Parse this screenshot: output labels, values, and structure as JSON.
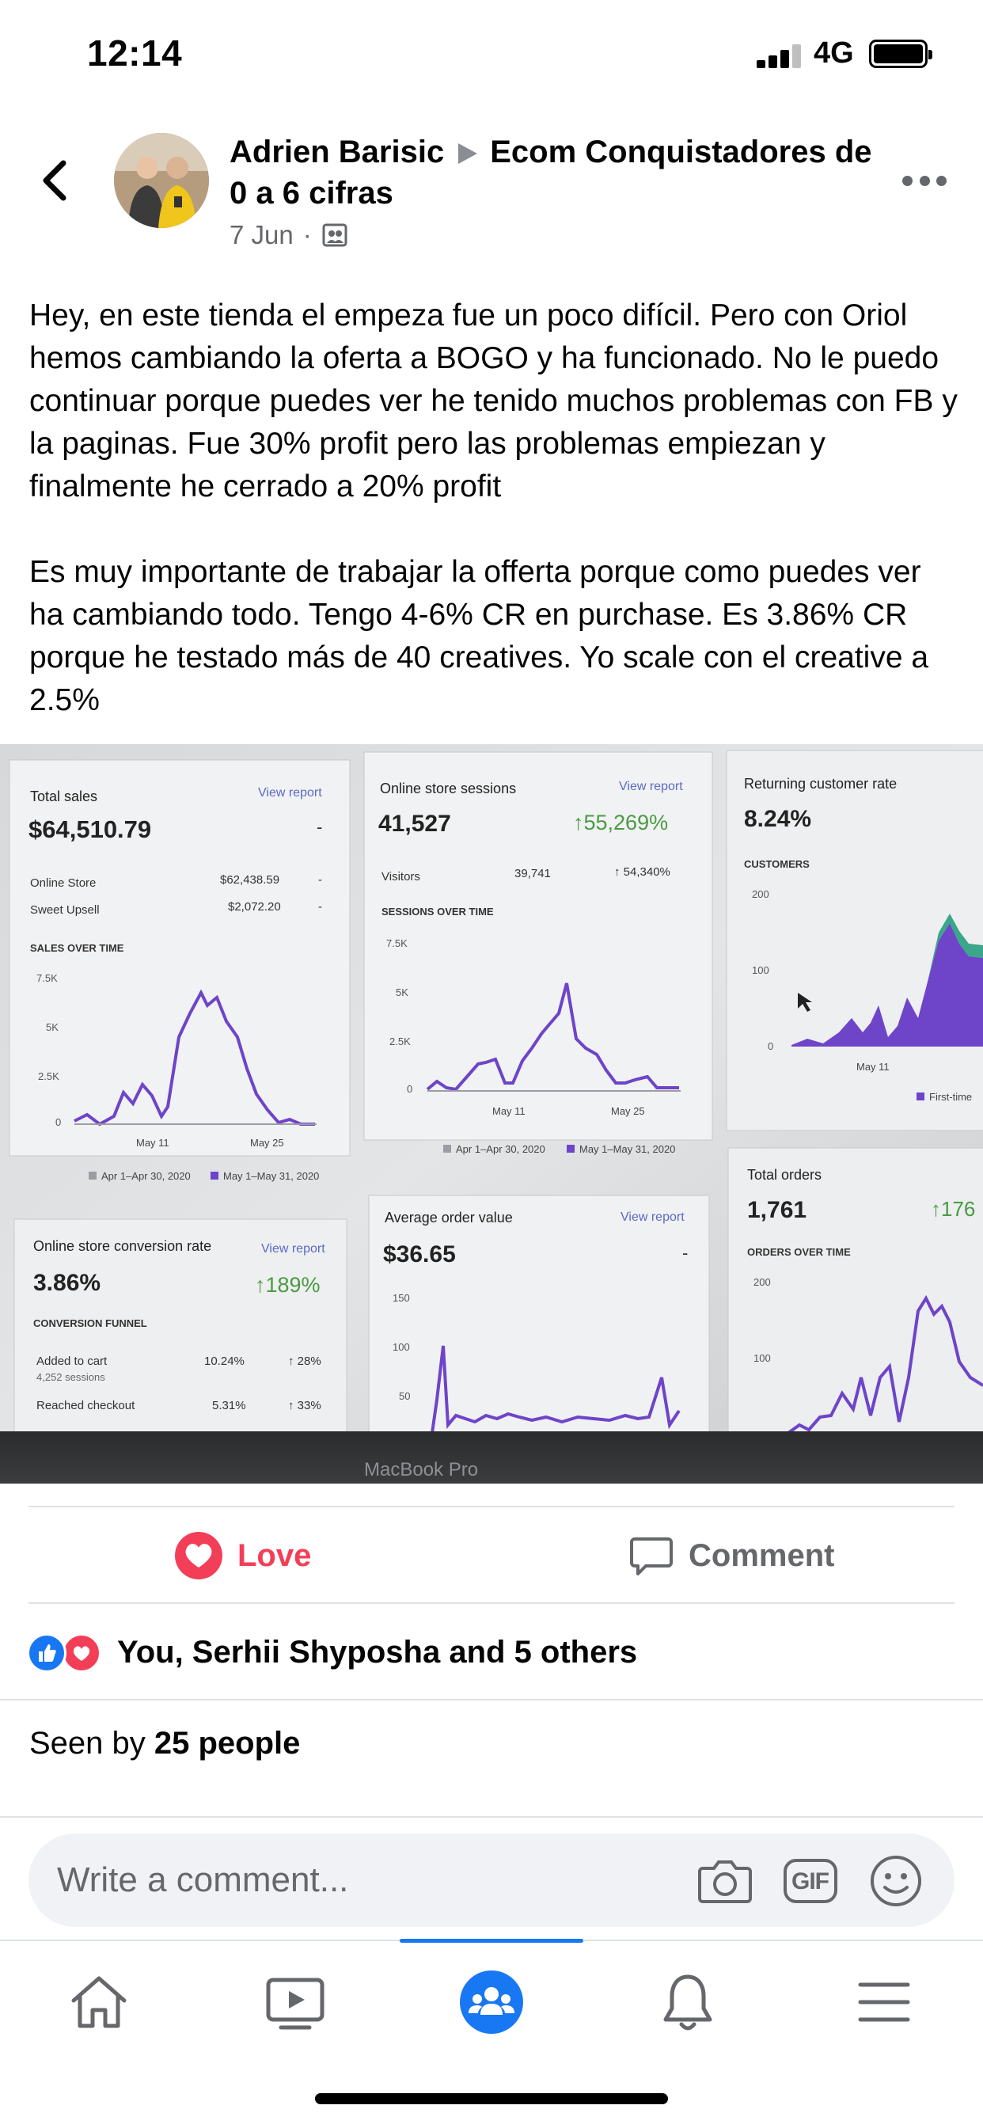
{
  "status_bar": {
    "time": "12:14",
    "network": "4G"
  },
  "post": {
    "author": "Adrien Barisic",
    "group": "Ecom Conquistadores de 0 a 6 cifras",
    "date": "7 Jun",
    "separator": "·",
    "privacy_icon": "group-members-icon",
    "paragraphs": [
      "Hey, en este tienda el empeza fue un poco difícil. Pero con Oriol hemos cambiando la oferta a BOGO y ha funcionado. No le puedo continuar porque puedes ver he tenido muchos problemas con FB y la paginas. Fue 30% profit pero las problemas empiezan y finalmente he cerrado a 20% profit",
      "Es muy importante de trabajar la offerta porque como puedes ver ha cambiando todo. Tengo 4-6% CR en purchase. Es 3.86% CR porque he testado más de 40 creatives. Yo scale con el creative a 2.5%"
    ],
    "photo": {
      "laptop_label": "MacBook Pro",
      "cards": {
        "total_sales": {
          "title": "Total sales",
          "link": "View report",
          "value": "$64,510.79",
          "change": "-",
          "rows": [
            {
              "label": "Online Store",
              "value": "$62,438.59",
              "change": "-"
            },
            {
              "label": "Sweet Upsell",
              "value": "$2,072.20",
              "change": "-"
            }
          ],
          "subtitle": "SALES OVER TIME",
          "y_ticks": [
            "7.5K",
            "5K",
            "2.5K",
            "0"
          ],
          "x_ticks": [
            "May 11",
            "May 25"
          ],
          "legend": [
            "Apr 1–Apr 30, 2020",
            "May 1–May 31, 2020"
          ]
        },
        "sessions": {
          "title": "Online store sessions",
          "link": "View report",
          "value": "41,527",
          "change": "↑55,269%",
          "rows": [
            {
              "label": "Visitors",
              "value": "39,741",
              "change": "↑ 54,340%"
            }
          ],
          "subtitle": "SESSIONS OVER TIME",
          "y_ticks": [
            "7.5K",
            "5K",
            "2.5K",
            "0"
          ],
          "x_ticks": [
            "May 11",
            "May 25"
          ],
          "legend": [
            "Apr 1–Apr 30, 2020",
            "May 1–May 31, 2020"
          ]
        },
        "returning": {
          "title": "Returning customer rate",
          "value": "8.24%",
          "subtitle": "CUSTOMERS",
          "y_ticks": [
            "200",
            "100",
            "0"
          ],
          "x_ticks": [
            "May 11"
          ],
          "legend": [
            "First-time"
          ]
        },
        "conversion": {
          "title": "Online store conversion rate",
          "link": "View report",
          "value": "3.86%",
          "change": "↑189%",
          "subtitle": "CONVERSION FUNNEL",
          "rows": [
            {
              "label": "Added to cart",
              "sub": "4,252 sessions",
              "value": "10.24%",
              "change": "↑ 28%"
            },
            {
              "label": "Reached checkout",
              "sub": "",
              "value": "5.31%",
              "change": "↑ 33%"
            }
          ]
        },
        "aov": {
          "title": "Average order value",
          "link": "View report",
          "value": "$36.65",
          "change": "-",
          "y_ticks": [
            "150",
            "100",
            "50"
          ]
        },
        "orders": {
          "title": "Total orders",
          "value": "1,761",
          "change": "↑176",
          "subtitle": "ORDERS OVER TIME",
          "y_ticks": [
            "200",
            "100"
          ]
        }
      }
    }
  },
  "actions": {
    "love_label": "Love",
    "comment_label": "Comment"
  },
  "reactions": {
    "text": "You, Serhii Shyposha and 5 others"
  },
  "seen": {
    "prefix": "Seen by ",
    "count": "25 people"
  },
  "comment_input": {
    "placeholder": "Write a comment...",
    "gif_label": "GIF"
  },
  "colors": {
    "facebook_blue": "#1877f2",
    "love_red": "#f33e58",
    "chart_purple": "#6e44c9",
    "chart_grey": "#9a9ea3",
    "shopify_green": "#4b9a43"
  },
  "tabs": [
    "home-icon",
    "watch-icon",
    "groups-icon",
    "notifications-icon",
    "menu-icon"
  ]
}
